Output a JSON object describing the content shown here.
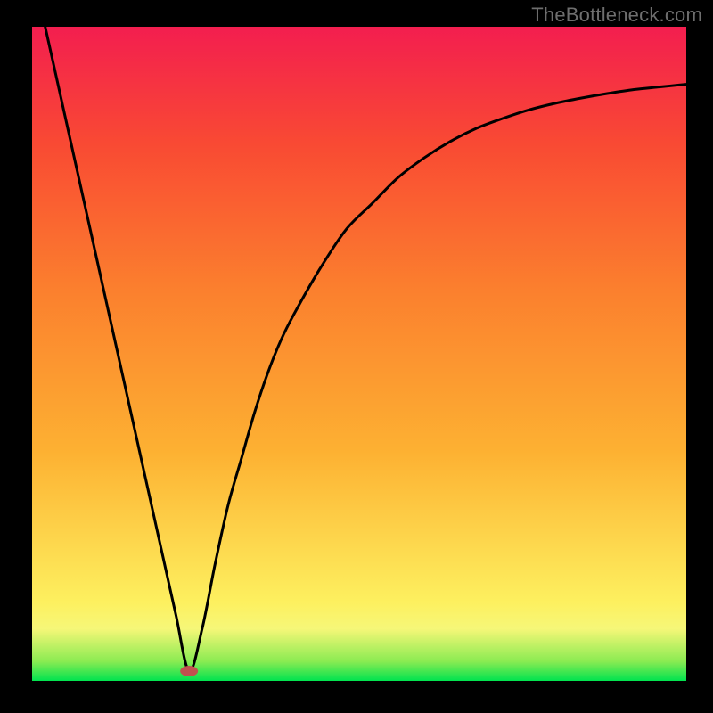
{
  "watermark": "TheBottleneck.com",
  "chart_data": {
    "type": "line",
    "title": "",
    "xlabel": "",
    "ylabel": "",
    "xlim": [
      0,
      100
    ],
    "ylim": [
      0,
      100
    ],
    "grid": false,
    "legend": false,
    "background_gradient": {
      "stops": [
        {
          "offset": 0.0,
          "color": "#00e34f"
        },
        {
          "offset": 0.03,
          "color": "#8beb52"
        },
        {
          "offset": 0.08,
          "color": "#f6f778"
        },
        {
          "offset": 0.12,
          "color": "#fdf05f"
        },
        {
          "offset": 0.35,
          "color": "#fdb132"
        },
        {
          "offset": 0.6,
          "color": "#fb7f2e"
        },
        {
          "offset": 0.82,
          "color": "#f94a33"
        },
        {
          "offset": 1.0,
          "color": "#f31e4f"
        }
      ]
    },
    "marker": {
      "x": 24,
      "y": 1.5,
      "color": "#c1524f"
    },
    "series": [
      {
        "name": "curve",
        "x": [
          2,
          4,
          6,
          8,
          10,
          12,
          14,
          16,
          18,
          20,
          22,
          24,
          26,
          28,
          30,
          32,
          34,
          36,
          38,
          40,
          44,
          48,
          52,
          56,
          60,
          64,
          68,
          72,
          76,
          80,
          84,
          88,
          92,
          96,
          100
        ],
        "y": [
          100,
          91,
          82,
          73,
          64,
          55,
          46,
          37,
          28,
          19,
          10,
          1.5,
          8,
          18,
          27,
          34,
          41,
          47,
          52,
          56,
          63,
          69,
          73,
          77,
          80,
          82.5,
          84.5,
          86,
          87.3,
          88.3,
          89.1,
          89.8,
          90.4,
          90.8,
          91.2
        ]
      }
    ]
  }
}
